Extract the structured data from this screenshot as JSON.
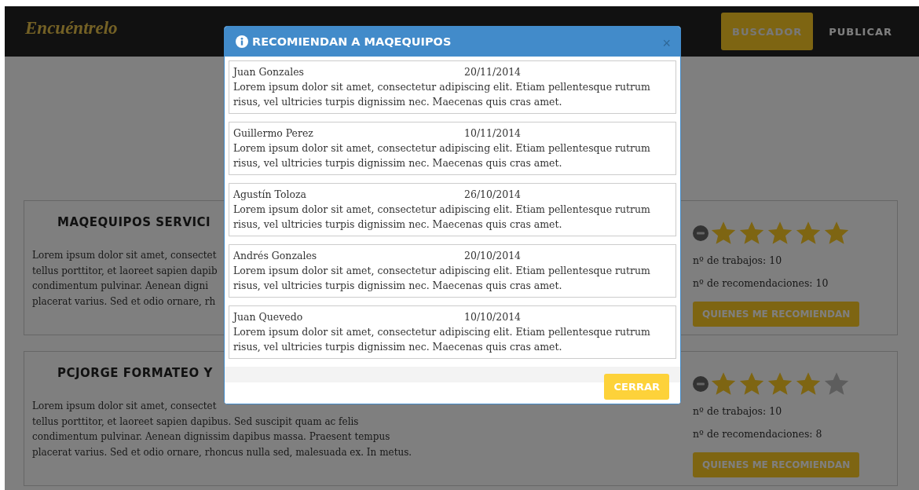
{
  "navbar": {
    "logo": "Encuéntrelo",
    "links": [
      {
        "label": "BUSCADOR",
        "selected": true
      },
      {
        "label": "PUBLICAR",
        "selected": false
      }
    ]
  },
  "listings": [
    {
      "title": "MAQEQUIPOS SERVICI",
      "description_lines": [
        "Lorem ipsum dolor sit amet, consectet",
        "tellus porttitor, et laoreet sapien dapib",
        "condimentum pulvinar. Aenean digni",
        "placerat varius. Sed et odio ornare, rh"
      ],
      "stars": 5,
      "stats": [
        "nº de trabajos: 10",
        "nº de recomendaciones: 10"
      ],
      "button": "QUIENES ME RECOMIENDAN"
    },
    {
      "title": "PCJORGE FORMATEO Y",
      "description_lines": [
        "Lorem ipsum dolor sit amet, consectet",
        "tellus porttitor, et laoreet sapien dapibus. Sed suscipit quam ac felis",
        "condimentum pulvinar. Aenean dignissim dapibus massa. Praesent tempus",
        "placerat varius. Sed et odio ornare, rhoncus nulla sed, malesuada ex. In metus."
      ],
      "stars": 4,
      "stats": [
        "nº de trabajos: 10",
        "nº de recomendaciones: 8"
      ],
      "button": "QUIENES ME RECOMIENDAN"
    }
  ],
  "modal": {
    "title": "RECOMIENDAN A MAQEQUIPOS",
    "close": "×",
    "recommendations": [
      {
        "name": "Juan Gonzales",
        "date": "20/11/2014",
        "text": "Lorem ipsum dolor sit amet, consectetur adipiscing elit. Etiam pellentesque rutrum risus, vel ultricies turpis dignissim nec. Maecenas quis cras amet."
      },
      {
        "name": "Guillermo Perez",
        "date": "10/11/2014",
        "text": "Lorem ipsum dolor sit amet, consectetur adipiscing elit. Etiam pellentesque rutrum risus, vel ultricies turpis dignissim nec. Maecenas quis cras amet."
      },
      {
        "name": "Agustín Toloza",
        "date": "26/10/2014",
        "text": "Lorem ipsum dolor sit amet, consectetur adipiscing elit. Etiam pellentesque rutrum risus, vel ultricies turpis dignissim nec. Maecenas quis cras amet."
      },
      {
        "name": "Andrés Gonzales",
        "date": "20/10/2014",
        "text": "Lorem ipsum dolor sit amet, consectetur adipiscing elit. Etiam pellentesque rutrum risus, vel ultricies turpis dignissim nec. Maecenas quis cras amet."
      },
      {
        "name": "Juan Quevedo",
        "date": "10/10/2014",
        "text": "Lorem ipsum dolor sit amet, consectetur adipiscing elit. Etiam pellentesque rutrum risus, vel ultricies turpis dignissim nec. Maecenas quis cras amet."
      }
    ],
    "button": "CERRAR"
  }
}
